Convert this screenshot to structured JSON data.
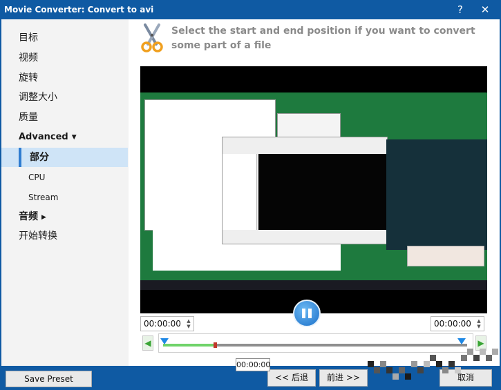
{
  "window": {
    "title": "Movie Converter:  Convert to avi",
    "help_label": "?",
    "close_label": "✕"
  },
  "sidebar": {
    "items": [
      {
        "label": "目标"
      },
      {
        "label": "视频"
      },
      {
        "label": "旋转"
      },
      {
        "label": "调整大小"
      },
      {
        "label": "质量"
      },
      {
        "label": "Advanced"
      },
      {
        "label": "部分"
      },
      {
        "label": "CPU"
      },
      {
        "label": "Stream"
      },
      {
        "label": "音频"
      },
      {
        "label": "开始转换"
      }
    ]
  },
  "main": {
    "heading": "Select the start and end position if you want to convert some part of a file",
    "start_time": "00:00:00",
    "end_time": "00:00:00",
    "tooltip_time": "00:00:00",
    "playback_progress": 0.17
  },
  "footer": {
    "save_preset": "Save Preset",
    "back": "<< 后退",
    "next": "前进 >>",
    "cancel": "取消"
  },
  "colors": {
    "titlebar": "#0f5aa3",
    "selection": "#cfe4f7",
    "accent": "#1e88e5",
    "heading_text": "#8a8a8a"
  }
}
